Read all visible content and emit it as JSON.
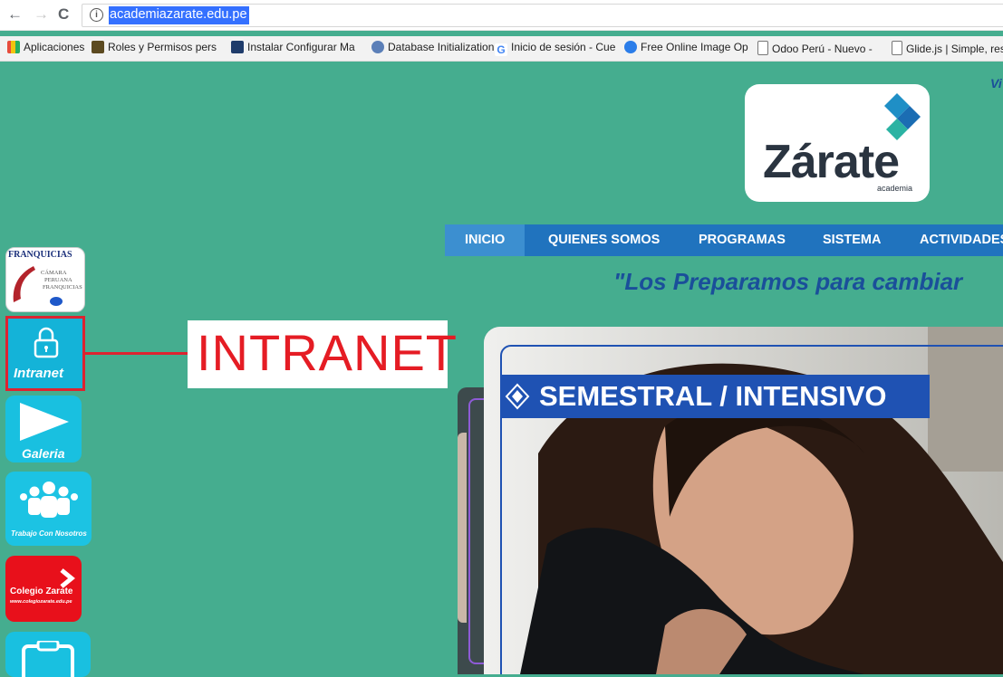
{
  "browser": {
    "url": "academiazarate.edu.pe",
    "nav": {
      "back": "←",
      "forward": "→",
      "reload": "C"
    },
    "bookmarks": [
      "Aplicaciones",
      "Roles y Permisos pers",
      "Instalar Configurar Ma",
      "Database Initialization",
      "Inicio de sesión - Cue",
      "Free Online Image Op",
      "Odoo Perú - Nuevo -",
      "Glide.js | Simple, resp"
    ]
  },
  "site": {
    "logo": "Zárate",
    "logo_sub": "academia",
    "top_right_fragment": "Vi",
    "menu": [
      "INICIO",
      "QUIENES SOMOS",
      "PROGRAMAS",
      "SISTEMA",
      "ACTIVIDADES"
    ],
    "slogan": "\"Los Preparamos para cambiar",
    "side_icons": {
      "franquicias_title": "FRANQUICIAS",
      "franquicias_sub": [
        "CÁMARA",
        "PERUANA",
        "FRANQUICIAS"
      ],
      "intranet": "Intranet",
      "galeria": "Galeria",
      "trabajo": "Trabajo Con Nosotros",
      "colegio": "Colegio Zarate",
      "colegio_url": "www.colegiozarate.edu.pe"
    },
    "annotation_label": "INTRANET",
    "banner_title": "SEMESTRAL / INTENSIVO",
    "colors": {
      "bg": "#45ad8f",
      "menu": "#2073be",
      "accent_red": "#dd2330"
    }
  }
}
